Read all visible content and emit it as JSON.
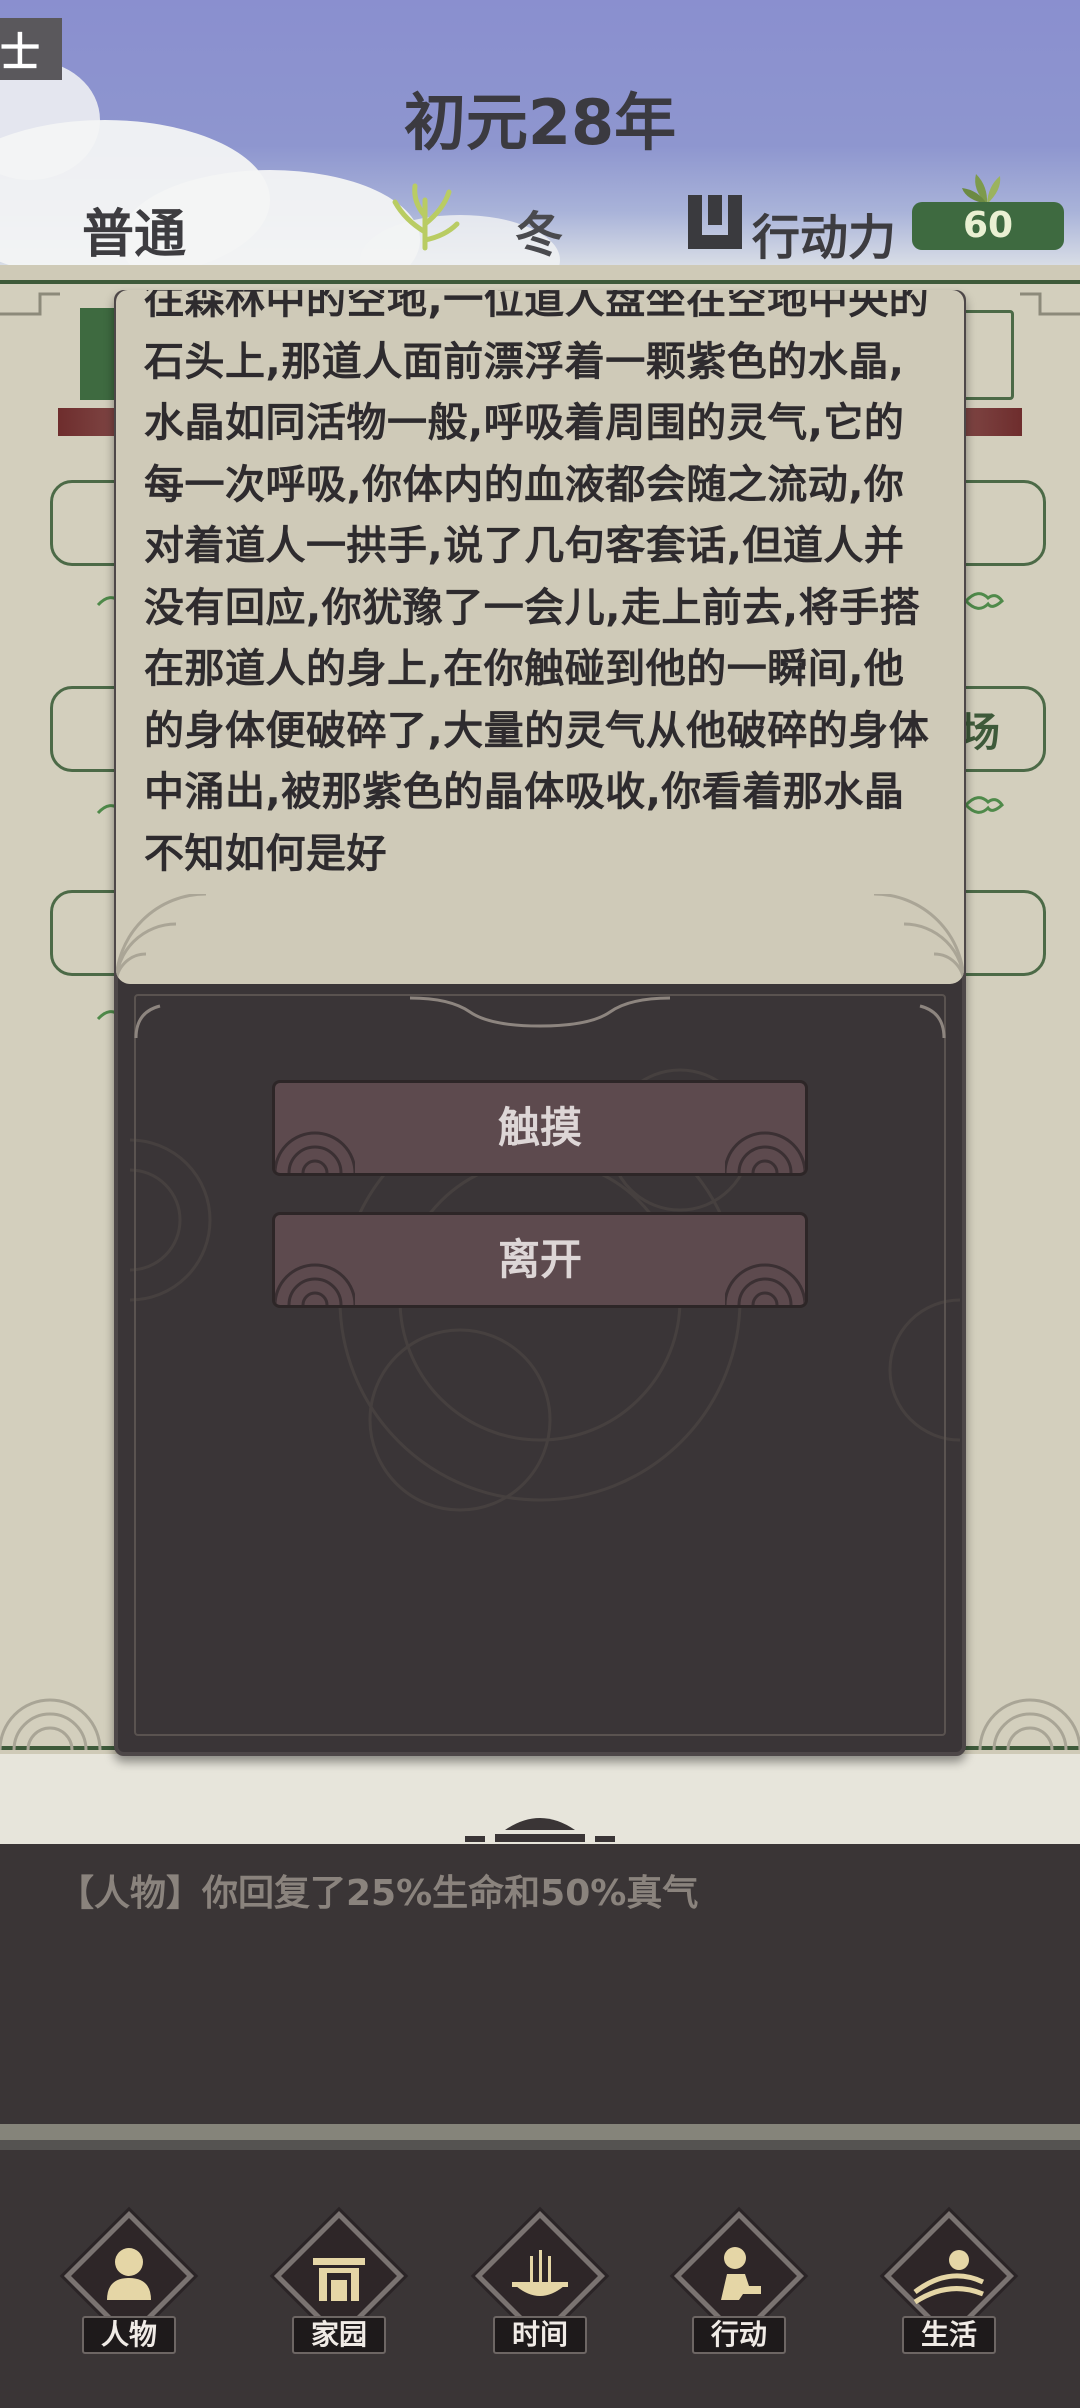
{
  "header": {
    "corner_tag": "士",
    "year_title": "初元28年",
    "difficulty": "普通",
    "season": "冬",
    "action_label": "行动力",
    "action_value": "60"
  },
  "background_panel": {
    "visible_fragment": "场"
  },
  "event_modal": {
    "text": "往森林中的空地,一位道人盘坐在空地中央的石头上,那道人面前漂浮着一颗紫色的水晶,水晶如同活物一般,呼吸着周围的灵气,它的每一次呼吸,你体内的血液都会随之流动,你对着道人一拱手,说了几句客套话,但道人并没有回应,你犹豫了一会儿,走上前去,将手搭在那道人的身上,在你触碰到他的一瞬间,他的身体便破碎了,大量的灵气从他破碎的身体中涌出,被那紫色的晶体吸收,你看着那水晶不知如何是好",
    "choices": [
      {
        "label": "触摸"
      },
      {
        "label": "离开"
      }
    ]
  },
  "log": {
    "entries": [
      "【人物】你回复了25%生命和50%真气"
    ]
  },
  "bottom_nav": {
    "items": [
      {
        "label": "人物",
        "icon": "person-icon"
      },
      {
        "label": "家园",
        "icon": "gate-icon"
      },
      {
        "label": "时间",
        "icon": "incense-icon"
      },
      {
        "label": "行动",
        "icon": "action-icon"
      },
      {
        "label": "生活",
        "icon": "field-icon"
      }
    ]
  },
  "colors": {
    "sky": "#8a8fcf",
    "accent_green": "#3e6a40",
    "modal_dark": "#3a3537",
    "parchment": "#cfcab8",
    "button": "#5d4a4e"
  }
}
